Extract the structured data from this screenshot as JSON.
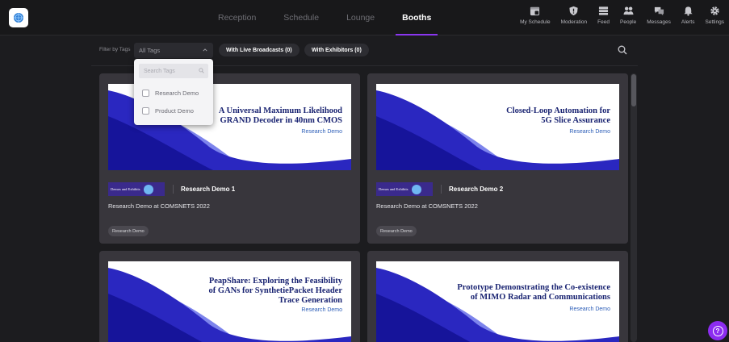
{
  "nav": {
    "tabs": [
      {
        "label": "Reception",
        "active": false
      },
      {
        "label": "Schedule",
        "active": false
      },
      {
        "label": "Lounge",
        "active": false
      },
      {
        "label": "Booths",
        "active": true
      }
    ]
  },
  "toolbar": {
    "items": [
      {
        "label": "My Schedule",
        "icon": "calendar-icon"
      },
      {
        "label": "Moderation",
        "icon": "shield-icon"
      },
      {
        "label": "Feed",
        "icon": "feed-icon"
      },
      {
        "label": "People",
        "icon": "people-icon"
      },
      {
        "label": "Messages",
        "icon": "messages-icon"
      },
      {
        "label": "Alerts",
        "icon": "bell-icon"
      },
      {
        "label": "Settings",
        "icon": "gear-icon"
      }
    ]
  },
  "filter": {
    "label": "Filter by Tags",
    "selected": "All Tags",
    "live_broadcasts": "With Live Broadcasts (0)",
    "exhibitors": "With Exhibitors (0)"
  },
  "dropdown": {
    "search_placeholder": "Search Tags",
    "options": [
      {
        "label": "Research Demo",
        "checked": false
      },
      {
        "label": "Product Demo",
        "checked": false
      }
    ]
  },
  "booths": [
    {
      "banner_title_1": "A Universal Maximum Likelihood",
      "banner_title_2": "GRAND Decoder in 40nm CMOS",
      "banner_title_3": "",
      "banner_sub": "Research Demo",
      "org_text": "Demos and Exhibits",
      "name": "Research Demo 1",
      "description": "Research Demo at COMSNETS 2022",
      "tag": "Research Demo"
    },
    {
      "banner_title_1": "Closed-Loop Automation for",
      "banner_title_2": "5G Slice Assurance",
      "banner_title_3": "",
      "banner_sub": "Research Demo",
      "org_text": "Demos and Exhibits",
      "name": "Research Demo 2",
      "description": "Research Demo at COMSNETS 2022",
      "tag": "Research Demo"
    },
    {
      "banner_title_1": "PeapShare: Exploring the Feasibility",
      "banner_title_2": "of GANs for SynthetiePacket Header",
      "banner_title_3": "Trace Generation",
      "banner_sub": "Research Demo",
      "org_text": "",
      "name": "",
      "description": "",
      "tag": ""
    },
    {
      "banner_title_1": "Prototype Demonstrating the Co-existence",
      "banner_title_2": "of MIMO Radar and Communications",
      "banner_title_3": "",
      "banner_sub": "Research Demo",
      "org_text": "",
      "name": "",
      "description": "",
      "tag": ""
    }
  ],
  "colors": {
    "accent": "#8a36f0",
    "banner_title": "#1a2472",
    "wave_dark": "#1d1aa8",
    "wave_light": "#7d84ec"
  }
}
